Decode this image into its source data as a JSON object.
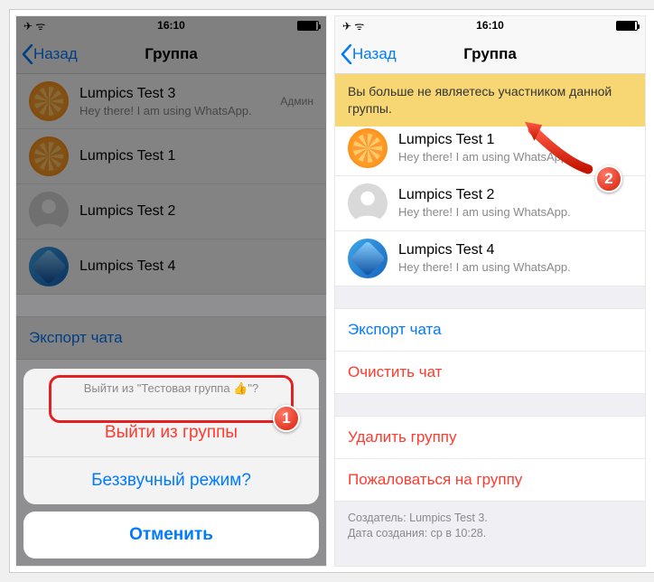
{
  "status": {
    "time": "16:10"
  },
  "nav": {
    "back": "Назад",
    "title": "Группа"
  },
  "left": {
    "members": [
      {
        "name": "Lumpics Test 3",
        "sub": "Hey there! I am using WhatsApp.",
        "admin": "Админ",
        "av": "orange"
      },
      {
        "name": "Lumpics Test 1",
        "sub": "",
        "av": "orange"
      },
      {
        "name": "Lumpics Test 2",
        "sub": "",
        "av": "gray"
      },
      {
        "name": "Lumpics Test 4",
        "sub": "",
        "av": "blue"
      }
    ],
    "export": "Экспорт чата",
    "sheet": {
      "title": "Выйти из \"Тестовая группа 👍\"?",
      "leave": "Выйти из группы",
      "mute": "Беззвучный режим?",
      "cancel": "Отменить"
    }
  },
  "right": {
    "banner": "Вы больше не являетесь участником данной группы.",
    "members": [
      {
        "name": "Lumpics Test 1",
        "sub": "Hey there! I am using WhatsApp.",
        "av": "orange"
      },
      {
        "name": "Lumpics Test 2",
        "sub": "Hey there! I am using WhatsApp.",
        "av": "gray"
      },
      {
        "name": "Lumpics Test 4",
        "sub": "Hey there! I am using WhatsApp.",
        "av": "blue"
      }
    ],
    "export": "Экспорт чата",
    "clear": "Очистить чат",
    "delete": "Удалить группу",
    "report": "Пожаловаться на группу",
    "meta1": "Создатель: Lumpics Test 3.",
    "meta2": "Дата создания: ср в 10:28."
  },
  "badges": {
    "b1": "1",
    "b2": "2"
  }
}
